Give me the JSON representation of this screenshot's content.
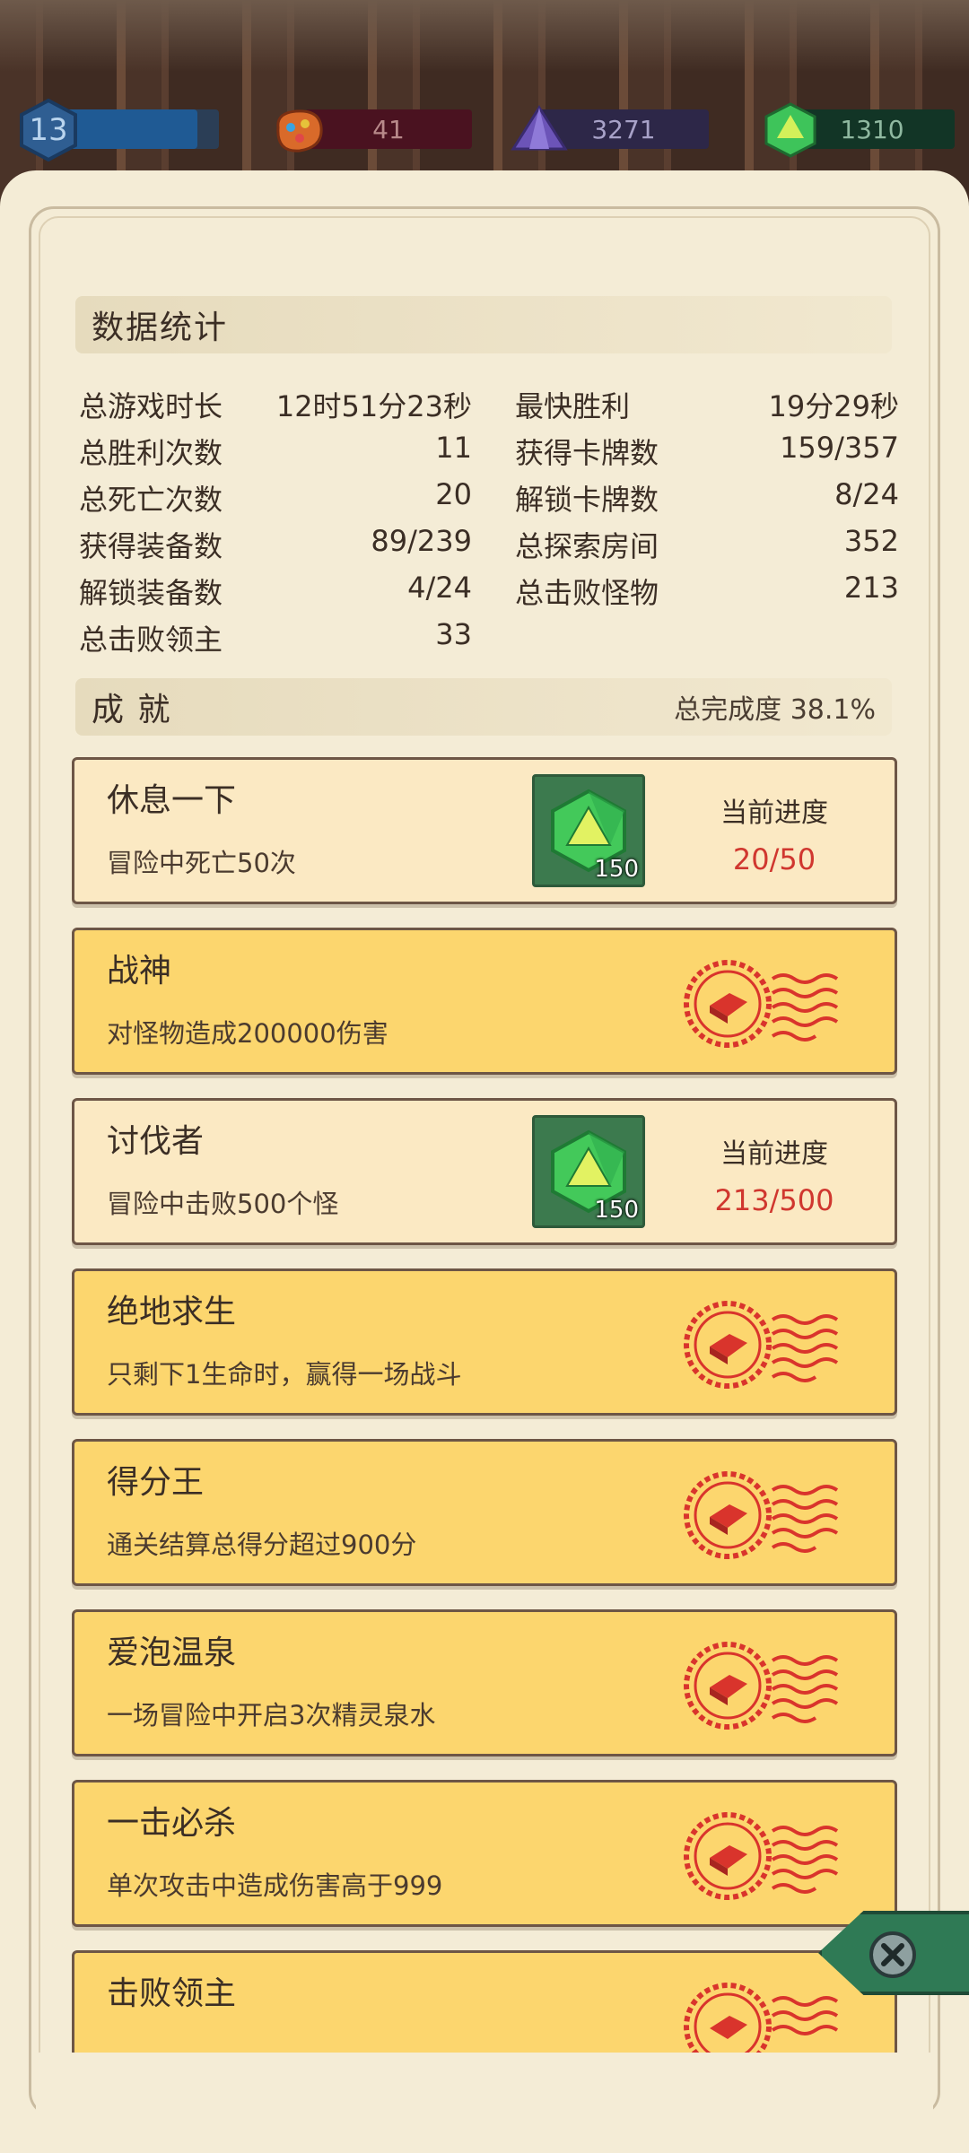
{
  "currency": {
    "level": "13",
    "gems": "41",
    "crystals": "3271",
    "dice": "1310"
  },
  "stats": {
    "title": "数据统计",
    "rows": [
      {
        "l_label": "总游戏时长",
        "l_value": "12时51分23秒",
        "r_label": "最快胜利",
        "r_value": "19分29秒"
      },
      {
        "l_label": "总胜利次数",
        "l_value": "11",
        "r_label": "获得卡牌数",
        "r_value": "159/357"
      },
      {
        "l_label": "总死亡次数",
        "l_value": "20",
        "r_label": "解锁卡牌数",
        "r_value": "8/24"
      },
      {
        "l_label": "获得装备数",
        "l_value": "89/239",
        "r_label": "总探索房间",
        "r_value": "352"
      },
      {
        "l_label": "解锁装备数",
        "l_value": "4/24",
        "r_label": "总击败怪物",
        "r_value": "213"
      },
      {
        "l_label": "总击败领主",
        "l_value": "33",
        "r_label": "",
        "r_value": ""
      }
    ]
  },
  "achievements": {
    "title": "成 就",
    "completion_label": "总完成度",
    "completion_value": "38.1%",
    "progress_label": "当前进度",
    "items": [
      {
        "title": "休息一下",
        "desc": "冒险中死亡50次",
        "status": "in-progress",
        "reward": "150",
        "progress": "20/50"
      },
      {
        "title": "战神",
        "desc": "对怪物造成200000伤害",
        "status": "done"
      },
      {
        "title": "讨伐者",
        "desc": "冒险中击败500个怪",
        "status": "in-progress",
        "reward": "150",
        "progress": "213/500"
      },
      {
        "title": "绝地求生",
        "desc": "只剩下1生命时，赢得一场战斗",
        "status": "done"
      },
      {
        "title": "得分王",
        "desc": "通关结算总得分超过900分",
        "status": "done"
      },
      {
        "title": "爱泡温泉",
        "desc": "一场冒险中开启3次精灵泉水",
        "status": "done"
      },
      {
        "title": "一击必杀",
        "desc": "单次攻击中造成伤害高于999",
        "status": "done"
      },
      {
        "title": "击败领主",
        "desc": "",
        "status": "done"
      }
    ]
  },
  "colors": {
    "done_card": "#fcd66e",
    "progress_card": "#fbe9c3",
    "progress_value": "#d0372f",
    "stamp": "#d9342c"
  }
}
